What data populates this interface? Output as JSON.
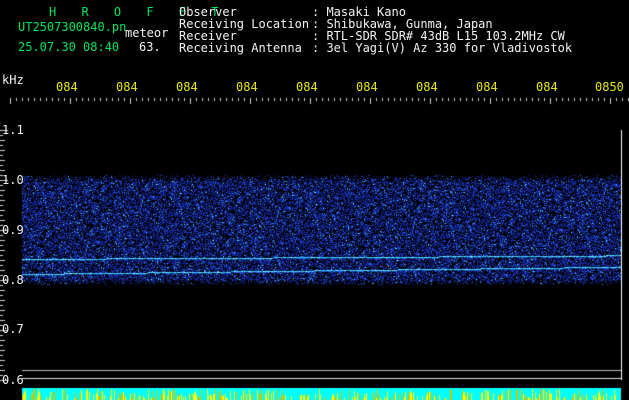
{
  "header": {
    "program": "H R O F F T",
    "filename": "UT2507300840.pn",
    "type": "meteor",
    "datetime": "25.07.30 08:40",
    "value": "63.",
    "labels": [
      "Observer",
      "Receiving Location",
      "Receiver",
      "Receiving Antenna"
    ],
    "values": [
      ": Masaki Kano",
      ": Shibukawa, Gunma, Japan",
      ": RTL-SDR SDR# 43dB L15 103.2MHz CW",
      ": 3el Yagi(V) Az 330 for Vladivostok"
    ]
  },
  "axis": {
    "unit": "kHz",
    "y_ticks": [
      "1.1",
      "1.0",
      "0.9",
      "0.8",
      "0.7",
      "0.6"
    ],
    "x_ticks": [
      "084",
      "084",
      "084",
      "084",
      "084",
      "084",
      "084",
      "084",
      "084",
      "0850"
    ]
  },
  "colors": {
    "background": "#000000",
    "header_green": "#00e35c",
    "text_white": "#f2f2f2",
    "time_yellow": "#e6e600",
    "noise_blue": "#1f3cc8",
    "bright_cyan": "#27d4ff",
    "bottom_bar": "#00ffff"
  },
  "spectrogram": {
    "band_top_khz": 1.0,
    "band_bottom_khz": 0.79,
    "carrier_khz": [
      0.812,
      0.842
    ]
  }
}
